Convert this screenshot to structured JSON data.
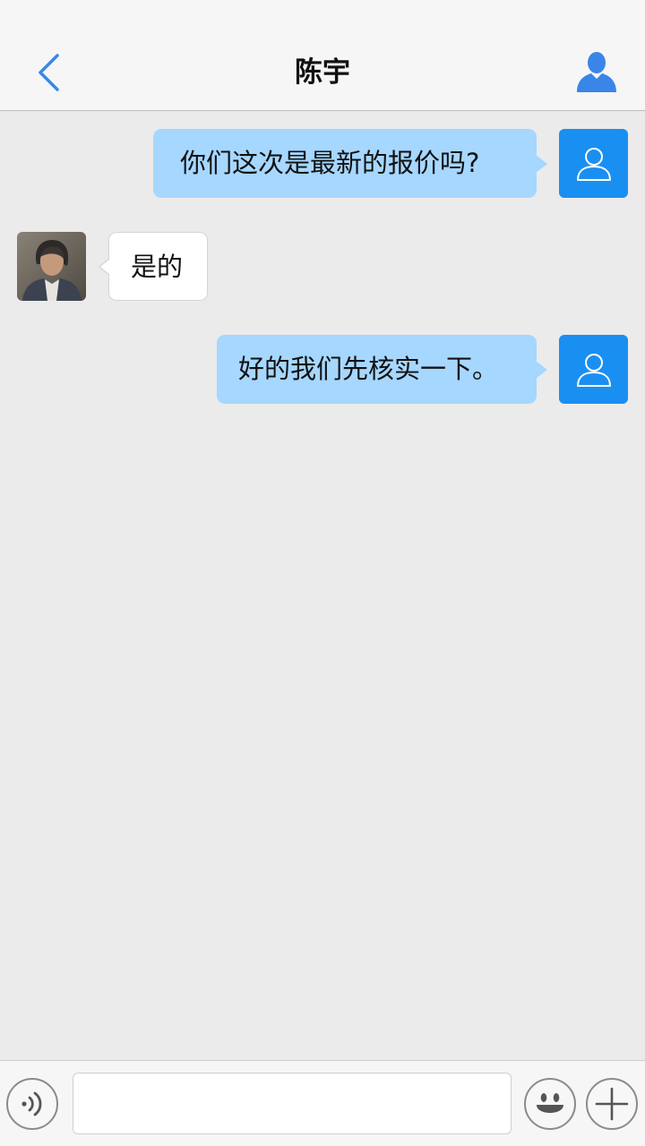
{
  "header": {
    "title": "陈宇",
    "back_icon": "chevron-left-icon",
    "profile_icon": "person-icon"
  },
  "messages": [
    {
      "direction": "outgoing",
      "text": "你们这次是最新的报价吗?"
    },
    {
      "direction": "incoming",
      "text": "是的"
    },
    {
      "direction": "outgoing",
      "text": "好的我们先核实一下。"
    }
  ],
  "input_bar": {
    "voice_icon": "voice-icon",
    "input_value": "",
    "emoji_icon": "smiley-icon",
    "add_icon": "plus-icon"
  },
  "colors": {
    "accent": "#1a8ff2",
    "outgoing_bubble": "#a6d7ff",
    "incoming_bubble": "#ffffff",
    "background": "#ebebeb"
  }
}
